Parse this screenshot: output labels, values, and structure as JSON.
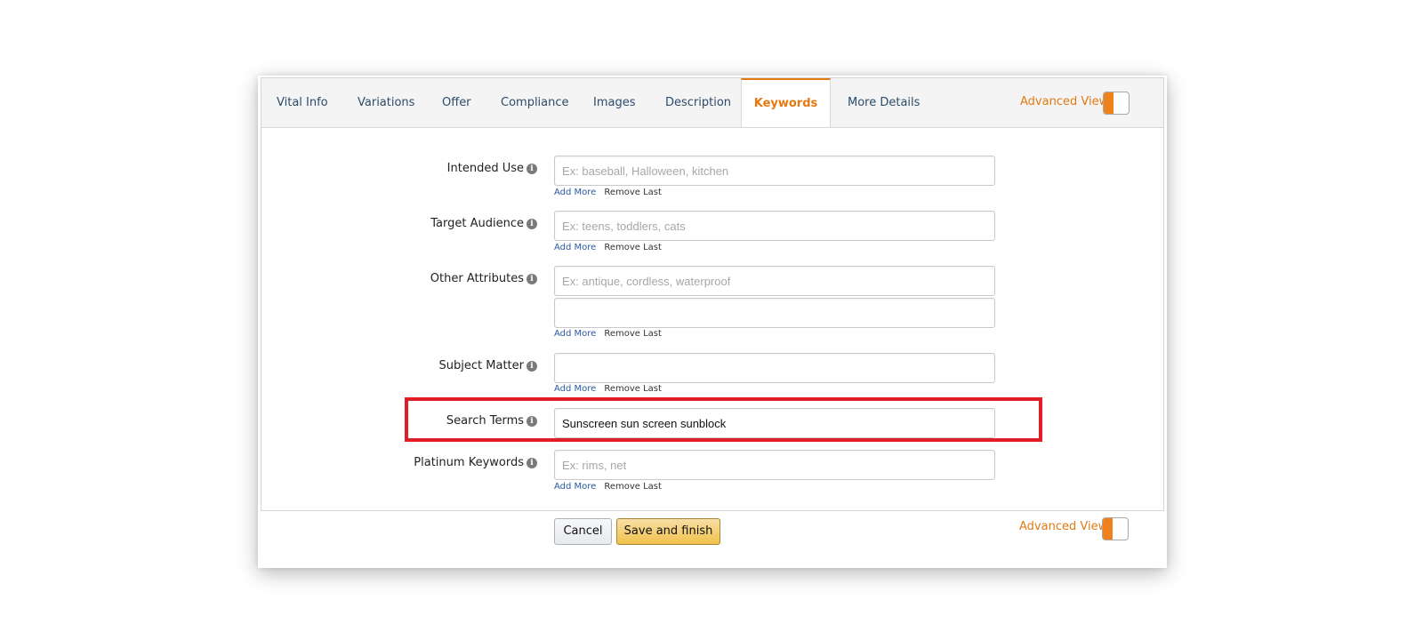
{
  "tabs": [
    {
      "label": "Vital Info",
      "active": false
    },
    {
      "label": "Variations",
      "active": false
    },
    {
      "label": "Offer",
      "active": false
    },
    {
      "label": "Compliance",
      "active": false
    },
    {
      "label": "Images",
      "active": false
    },
    {
      "label": "Description",
      "active": false
    },
    {
      "label": "Keywords",
      "active": true
    },
    {
      "label": "More Details",
      "active": false
    }
  ],
  "advanced_view": {
    "label": "Advanced View",
    "enabled": true
  },
  "fields": {
    "intended_use": {
      "label": "Intended Use",
      "inputs": [
        {
          "value": "",
          "placeholder": "Ex: baseball, Halloween, kitchen"
        }
      ]
    },
    "target_audience": {
      "label": "Target Audience",
      "inputs": [
        {
          "value": "",
          "placeholder": "Ex: teens, toddlers, cats"
        }
      ]
    },
    "other_attributes": {
      "label": "Other Attributes",
      "inputs": [
        {
          "value": "",
          "placeholder": "Ex: antique, cordless, waterproof"
        },
        {
          "value": "",
          "placeholder": ""
        }
      ]
    },
    "subject_matter": {
      "label": "Subject Matter",
      "inputs": [
        {
          "value": "",
          "placeholder": ""
        }
      ]
    },
    "search_terms": {
      "label": "Search Terms",
      "inputs": [
        {
          "value": "Sunscreen sun screen sunblock",
          "placeholder": ""
        }
      ],
      "highlighted": true
    },
    "platinum_keywords": {
      "label": "Platinum Keywords",
      "inputs": [
        {
          "value": "",
          "placeholder": "Ex: rims, net"
        }
      ]
    }
  },
  "links": {
    "add_more": "Add More",
    "remove_last": "Remove Last"
  },
  "info_glyph": "i",
  "buttons": {
    "cancel": "Cancel",
    "save": "Save and finish"
  },
  "colors": {
    "accent": "#e47911",
    "toggle_on": "#f0821e",
    "highlight_box": "#e01e25",
    "link": "#2b5aa0",
    "save_button": "#f0c14b"
  }
}
